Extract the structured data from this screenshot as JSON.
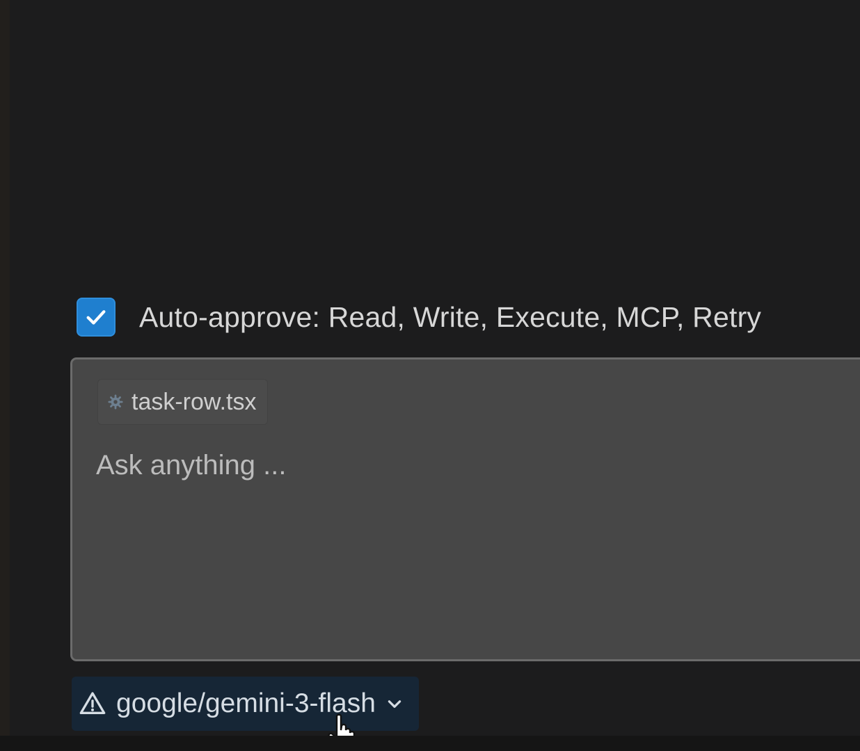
{
  "auto_approve": {
    "checked": true,
    "label": "Auto-approve: Read, Write, Execute, MCP, Retry"
  },
  "chat_input": {
    "attached_file": {
      "icon": "gear-icon",
      "name": "task-row.tsx"
    },
    "placeholder": "Ask anything ..."
  },
  "model_selector": {
    "icon": "warning-icon",
    "model": "google/gemini-3-flash",
    "dropdown_icon": "chevron-down-icon"
  },
  "colors": {
    "background": "#1c1c1d",
    "checkbox": "#1f7fcf",
    "input_bg": "#474747",
    "model_selector_bg": "#162636"
  }
}
